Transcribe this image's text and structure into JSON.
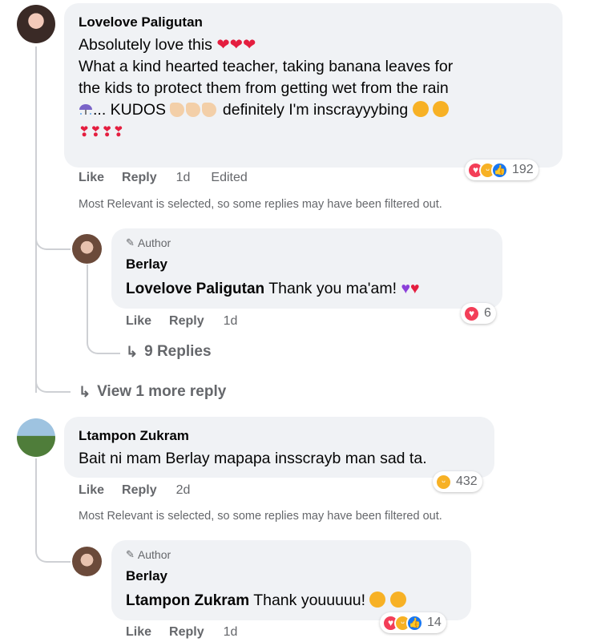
{
  "comment1": {
    "author": "Lovelove Paligutan",
    "line1": "Absolutely love this",
    "line2": "What a kind hearted teacher, taking banana leaves for",
    "line3": "the kids to protect them from getting wet from the rain",
    "line4_pre": "... KUDOS",
    "line4_post": "definitely I'm inscrayyybing",
    "like": "Like",
    "reply": "Reply",
    "time": "1d",
    "edited": "Edited",
    "reaction_count": "192",
    "filter_note": "Most Relevant is selected, so some replies may have been filtered out."
  },
  "reply1": {
    "badge": "Author",
    "author": "Berlay",
    "mention": "Lovelove Paligutan",
    "text": "Thank you ma'am!",
    "like": "Like",
    "reply": "Reply",
    "time": "1d",
    "reaction_count": "6",
    "replies_link": "9 Replies"
  },
  "more_replies": "View 1 more reply",
  "comment2": {
    "author": "Ltampon Zukram",
    "text": "Bait ni mam Berlay mapapa insscrayb man sad ta.",
    "like": "Like",
    "reply": "Reply",
    "time": "2d",
    "reaction_count": "432",
    "filter_note": "Most Relevant is selected, so some replies may have been filtered out."
  },
  "reply2": {
    "badge": "Author",
    "author": "Berlay",
    "mention": "Ltampon Zukram",
    "text": "Thank youuuuu!",
    "like": "Like",
    "reply": "Reply",
    "time": "1d",
    "reaction_count": "14"
  },
  "colors": {
    "bubble": "#f0f2f5",
    "secondary_text": "#65676b",
    "love": "#f33e58",
    "haha": "#f7b125",
    "like": "#1877f2"
  }
}
